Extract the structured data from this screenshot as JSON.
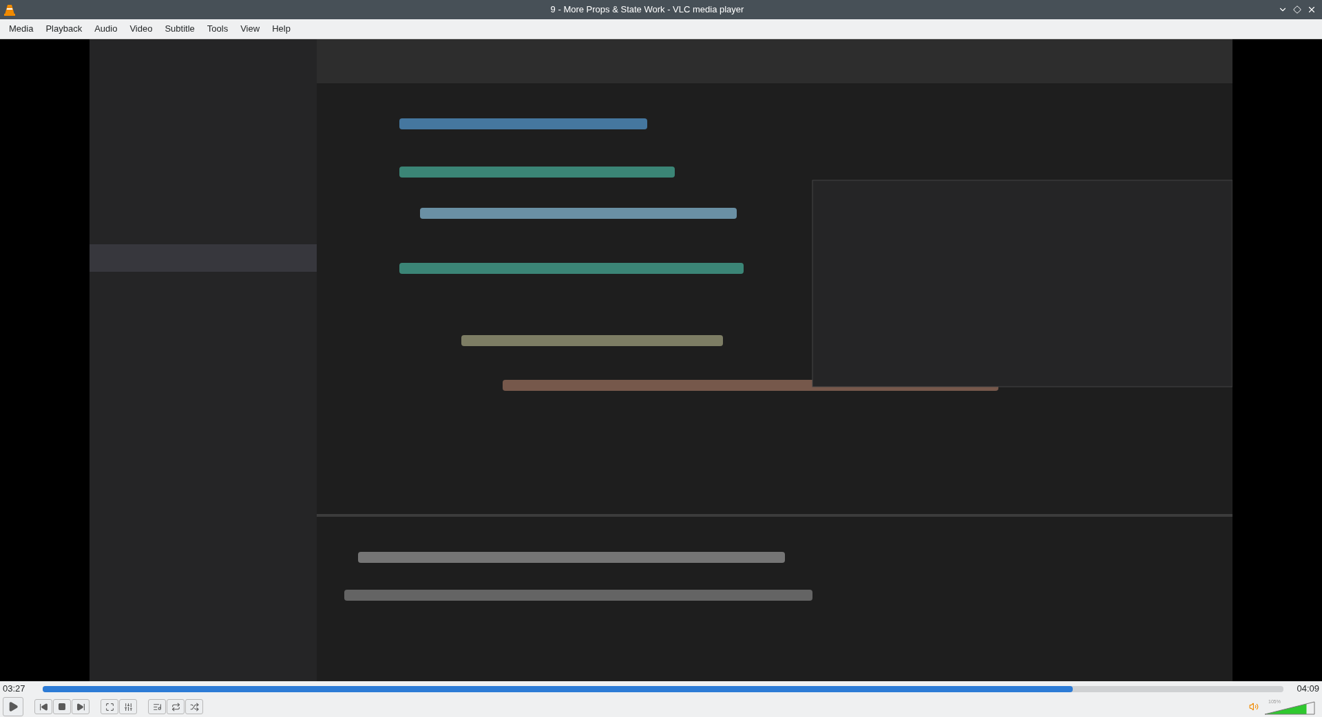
{
  "window": {
    "title": "9 - More Props & State Work - VLC media player"
  },
  "menu": [
    "Media",
    "Playback",
    "Audio",
    "Video",
    "Subtitle",
    "Tools",
    "View",
    "Help"
  ],
  "seek": {
    "elapsed": "03:27",
    "total": "04:09",
    "level": 0.83
  },
  "volume": {
    "reading": "105%",
    "level": 0.84
  }
}
